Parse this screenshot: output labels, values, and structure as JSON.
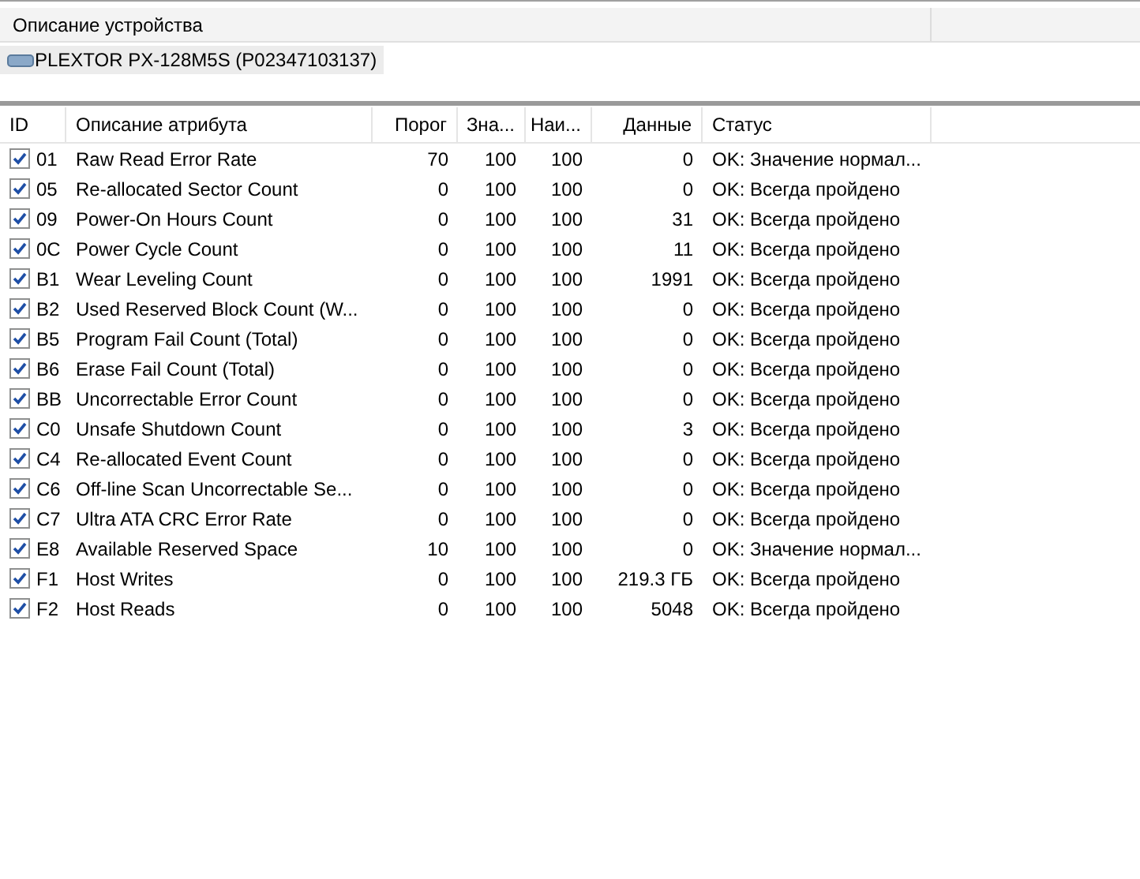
{
  "device_panel": {
    "header": "Описание устройства",
    "devices": [
      {
        "name": "PLEXTOR PX-128M5S (P02347103137)",
        "selected": true
      }
    ]
  },
  "table": {
    "columns": [
      "ID",
      "Описание атрибута",
      "Порог",
      "Зна...",
      "Наи...",
      "Данные",
      "Статус"
    ],
    "rows": [
      {
        "checked": true,
        "id": "01",
        "name": "Raw Read Error Rate",
        "threshold": "70",
        "value": "100",
        "worst": "100",
        "data": "0",
        "status": "OK: Значение нормал..."
      },
      {
        "checked": true,
        "id": "05",
        "name": "Re-allocated Sector Count",
        "threshold": "0",
        "value": "100",
        "worst": "100",
        "data": "0",
        "status": "OK: Всегда пройдено"
      },
      {
        "checked": true,
        "id": "09",
        "name": "Power-On Hours Count",
        "threshold": "0",
        "value": "100",
        "worst": "100",
        "data": "31",
        "status": "OK: Всегда пройдено"
      },
      {
        "checked": true,
        "id": "0C",
        "name": "Power Cycle Count",
        "threshold": "0",
        "value": "100",
        "worst": "100",
        "data": "11",
        "status": "OK: Всегда пройдено"
      },
      {
        "checked": true,
        "id": "B1",
        "name": "Wear Leveling Count",
        "threshold": "0",
        "value": "100",
        "worst": "100",
        "data": "1991",
        "status": "OK: Всегда пройдено"
      },
      {
        "checked": true,
        "id": "B2",
        "name": "Used Reserved Block Count (W...",
        "threshold": "0",
        "value": "100",
        "worst": "100",
        "data": "0",
        "status": "OK: Всегда пройдено"
      },
      {
        "checked": true,
        "id": "B5",
        "name": "Program Fail Count (Total)",
        "threshold": "0",
        "value": "100",
        "worst": "100",
        "data": "0",
        "status": "OK: Всегда пройдено"
      },
      {
        "checked": true,
        "id": "B6",
        "name": "Erase Fail Count (Total)",
        "threshold": "0",
        "value": "100",
        "worst": "100",
        "data": "0",
        "status": "OK: Всегда пройдено"
      },
      {
        "checked": true,
        "id": "BB",
        "name": "Uncorrectable Error Count",
        "threshold": "0",
        "value": "100",
        "worst": "100",
        "data": "0",
        "status": "OK: Всегда пройдено"
      },
      {
        "checked": true,
        "id": "C0",
        "name": "Unsafe Shutdown Count",
        "threshold": "0",
        "value": "100",
        "worst": "100",
        "data": "3",
        "status": "OK: Всегда пройдено"
      },
      {
        "checked": true,
        "id": "C4",
        "name": "Re-allocated Event Count",
        "threshold": "0",
        "value": "100",
        "worst": "100",
        "data": "0",
        "status": "OK: Всегда пройдено"
      },
      {
        "checked": true,
        "id": "C6",
        "name": "Off-line Scan Uncorrectable Se...",
        "threshold": "0",
        "value": "100",
        "worst": "100",
        "data": "0",
        "status": "OK: Всегда пройдено"
      },
      {
        "checked": true,
        "id": "C7",
        "name": "Ultra ATA CRC Error Rate",
        "threshold": "0",
        "value": "100",
        "worst": "100",
        "data": "0",
        "status": "OK: Всегда пройдено"
      },
      {
        "checked": true,
        "id": "E8",
        "name": "Available Reserved Space",
        "threshold": "10",
        "value": "100",
        "worst": "100",
        "data": "0",
        "status": "OK: Значение нормал..."
      },
      {
        "checked": true,
        "id": "F1",
        "name": "Host Writes",
        "threshold": "0",
        "value": "100",
        "worst": "100",
        "data": "219.3 ГБ",
        "status": "OK: Всегда пройдено"
      },
      {
        "checked": true,
        "id": "F2",
        "name": "Host Reads",
        "threshold": "0",
        "value": "100",
        "worst": "100",
        "data": "5048",
        "status": "OK: Всегда пройдено"
      }
    ]
  }
}
